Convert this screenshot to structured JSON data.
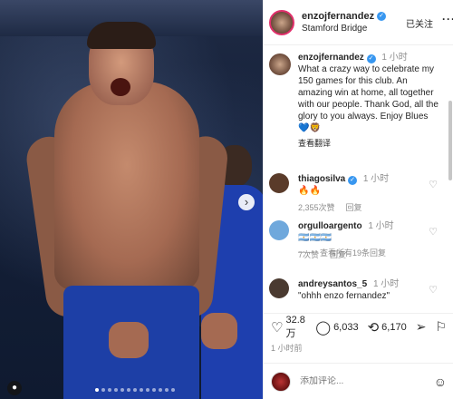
{
  "post": {
    "username": "enzojfernandez",
    "location": "Stamford Bridge",
    "follow_status": "已关注",
    "more_icon": "more-horizontal-icon",
    "caption_time": "1 小时",
    "caption": "What a crazy way to celebrate my 150 games for this club. An amazing win at home, all together with our people. Thank God, all the glory to you always. Enjoy Blues 💙🦁",
    "translate": "查看翻译"
  },
  "comments": [
    {
      "user": "thiagosilva",
      "text": "🔥🔥",
      "time": "1 小时",
      "likes": "2,355次赞",
      "reply": "回复",
      "avatar_color": "#5a3b2a"
    },
    {
      "user": "orgulloargento",
      "text": "🇦🇷🇦🇷🇦🇷",
      "time": "1 小时",
      "likes": "7次赞",
      "reply": "回复",
      "avatar_color": "#6fa8dc"
    },
    {
      "user": "andreysantos_5",
      "text": "\"ohhh enzo fernandez\"",
      "time": "1 小时",
      "avatar_color": "#4a3a30"
    }
  ],
  "view_replies": "查看所有19条回复",
  "actions": {
    "likes": "32.8 万",
    "comments": "6,033",
    "shares": "6,170"
  },
  "post_time": "1 小时前",
  "composer": {
    "placeholder": "添加评论..."
  },
  "colors": {
    "verified": "#3897f0",
    "kit_blue": "#1d3fa6"
  }
}
